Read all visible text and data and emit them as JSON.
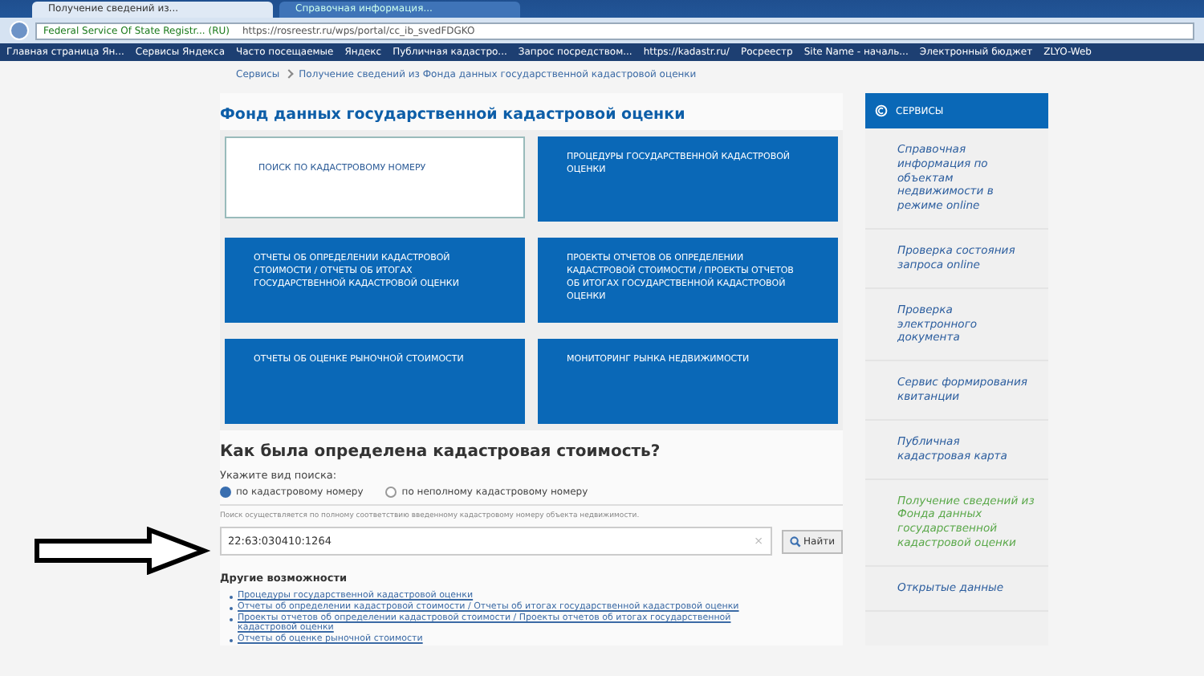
{
  "browser": {
    "tabs": [
      {
        "label": "Получение сведений из...",
        "selected": true
      },
      {
        "label": "Справочная информация...",
        "selected": false
      }
    ],
    "site_identity": "Federal Service Of State Registr... (RU)",
    "url": "https://rosreestr.ru/wps/portal/cc_ib_svedFDGKO",
    "bookmarks": [
      "Главная страница Ян...",
      "Сервисы Яндекса",
      "Часто посещаемые",
      "Яндекс",
      "Публичная кадастро...",
      "Запрос посредством...",
      "https://kadastr.ru/",
      "Росреестр",
      "Site Name - началь...",
      "Электронный бюджет",
      "ZLYO-Web"
    ]
  },
  "breadcrumbs": [
    "Сервисы",
    "Получение сведений из Фонда данных государственной кадастровой оценки"
  ],
  "page_title": "Фонд данных государственной кадастровой оценки",
  "tiles": [
    {
      "label": "ПОИСК ПО КАДАСТРОВОМУ НОМЕРУ",
      "selected": true
    },
    {
      "label": "ПРОЦЕДУРЫ ГОСУДАРСТВЕННОЙ КАДАСТРОВОЙ ОЦЕНКИ",
      "selected": false
    },
    {
      "label": "ОТЧЕТЫ ОБ ОПРЕДЕЛЕНИИ КАДАСТРОВОЙ СТОИМОСТИ / ОТЧЕТЫ ОБ ИТОГАХ ГОСУДАРСТВЕННОЙ КАДАСТРОВОЙ ОЦЕНКИ",
      "selected": false
    },
    {
      "label": "ПРОЕКТЫ ОТЧЕТОВ ОБ ОПРЕДЕЛЕНИИ КАДАСТРОВОЙ СТОИМОСТИ / ПРОЕКТЫ ОТЧЕТОВ ОБ ИТОГАХ ГОСУДАРСТВЕННОЙ КАДАСТРОВОЙ ОЦЕНКИ",
      "selected": false
    },
    {
      "label": "ОТЧЕТЫ ОБ ОЦЕНКЕ РЫНОЧНОЙ СТОИМОСТИ",
      "selected": false
    },
    {
      "label": "МОНИТОРИНГ РЫНКА НЕДВИЖИМОСТИ",
      "selected": false
    }
  ],
  "search": {
    "heading": "Как была определена кадастровая стоимость?",
    "prompt": "Укажите вид поиска:",
    "options": [
      {
        "label": "по кадастровому номеру",
        "selected": true
      },
      {
        "label": "по неполному кадастровому номеру",
        "selected": false
      }
    ],
    "hint": "Поиск осуществляется по полному соответствию введенному кадастровому номеру объекта недвижимости.",
    "value": "22:63:030410:1264",
    "clear": "×",
    "button": "Найти"
  },
  "other": {
    "heading": "Другие возможности",
    "links": [
      "Процедуры государственной кадастровой оценки",
      "Отчеты об определении кадастровой стоимости / Отчеты об итогах государственной кадастровой оценки",
      "Проекты отчетов об определении кадастровой стоимости / Проекты отчетов об итогах государственной кадастровой оценки",
      "Отчеты об оценке рыночной стоимости"
    ]
  },
  "sidebar": {
    "title": "СЕРВИСЫ",
    "items": [
      {
        "label": "Справочная информация по объектам недвижимости в режиме online",
        "selected": false
      },
      {
        "label": "Проверка состояния запроса online",
        "selected": false
      },
      {
        "label": "Проверка электронного документа",
        "selected": false
      },
      {
        "label": "Сервис формирования квитанции",
        "selected": false
      },
      {
        "label": "Публичная кадастровая карта",
        "selected": false
      },
      {
        "label": "Получение сведений из Фонда данных государственной кадастровой оценки",
        "selected": true
      },
      {
        "label": "Открытые данные",
        "selected": false
      }
    ]
  }
}
